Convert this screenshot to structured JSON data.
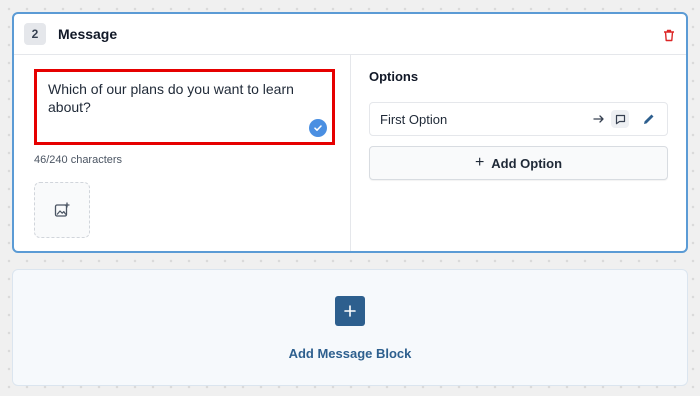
{
  "message_card": {
    "step_number": "2",
    "title": "Message",
    "message_text": "Which of our plans do you want to learn about?",
    "char_count": "46/240 characters"
  },
  "options_panel": {
    "title": "Options",
    "options": [
      {
        "label": "First Option"
      }
    ],
    "add_option_label": "Add Option"
  },
  "add_block": {
    "label": "Add Message Block"
  },
  "colors": {
    "card_border": "#5b9bd5",
    "highlight_border": "#e60000",
    "delete_icon": "#dc2626",
    "check_badge": "#4a8fe2",
    "add_block_accent": "#2d5f8e"
  },
  "icons": {
    "delete": "trash-icon",
    "check": "check-circle-icon",
    "image_upload": "image-plus-icon",
    "arrow": "arrow-right-icon",
    "message_target": "message-square-icon",
    "edit": "pencil-icon",
    "add_option": "plus-icon",
    "add_block": "plus-icon"
  }
}
